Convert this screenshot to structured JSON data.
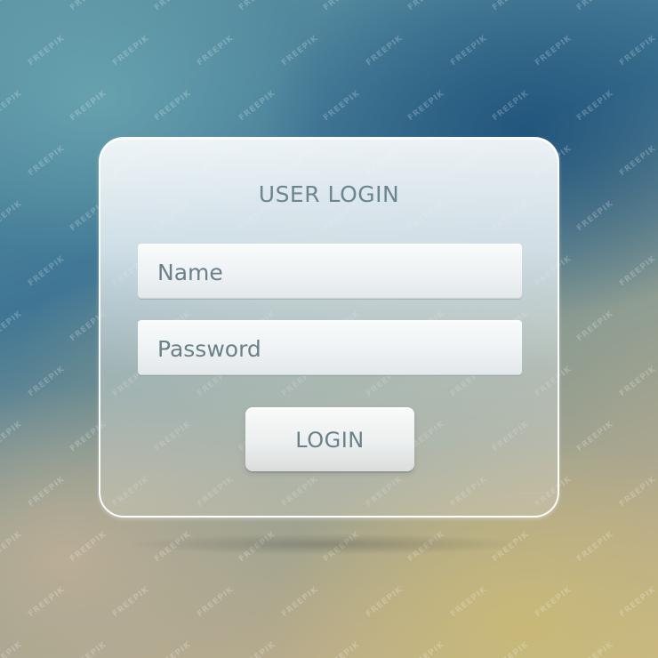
{
  "login_form": {
    "title": "USER LOGIN",
    "name_field": {
      "placeholder": "Name"
    },
    "password_field": {
      "placeholder": "Password"
    },
    "submit_label": "LOGIN"
  },
  "watermark": {
    "text": "FREEPIK"
  },
  "colors": {
    "label_text": "#6a8189",
    "card_border": "#ffffff",
    "background_teal": "#3f7694",
    "background_sand": "#c9b987"
  }
}
